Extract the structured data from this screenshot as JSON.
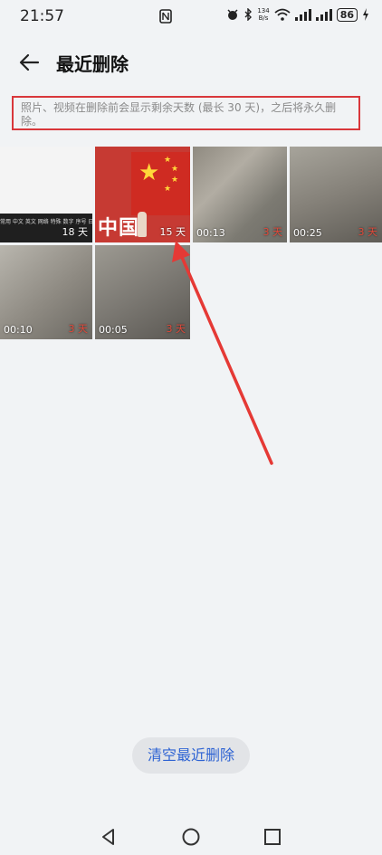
{
  "status_bar": {
    "time": "21:57",
    "network_speed_value": "134",
    "network_speed_unit": "B/s",
    "battery": "86"
  },
  "header": {
    "title": "最近删除"
  },
  "notice": {
    "text": "照片、视频在删除前会显示剩余天数 (最长 30 天)，之后将永久删除。"
  },
  "items": [
    {
      "duration": "",
      "days": "18 天",
      "days_color": "white"
    },
    {
      "duration": "",
      "days": "15 天",
      "days_color": "white",
      "overlay_text": "中国"
    },
    {
      "duration": "00:13",
      "days": "3 天",
      "days_color": "red"
    },
    {
      "duration": "00:25",
      "days": "3 天",
      "days_color": "red"
    },
    {
      "duration": "00:10",
      "days": "3 天",
      "days_color": "red"
    },
    {
      "duration": "00:05",
      "days": "3 天",
      "days_color": "red"
    }
  ],
  "keyboard_strip": "常用 中文 英文 网络 特殊 数字 序号 日",
  "actions": {
    "clear_label": "清空最近删除"
  },
  "colors": {
    "accent_blue": "#2e63d3",
    "annotation_red": "#d9373b",
    "remaining_red": "#e14a3b"
  }
}
